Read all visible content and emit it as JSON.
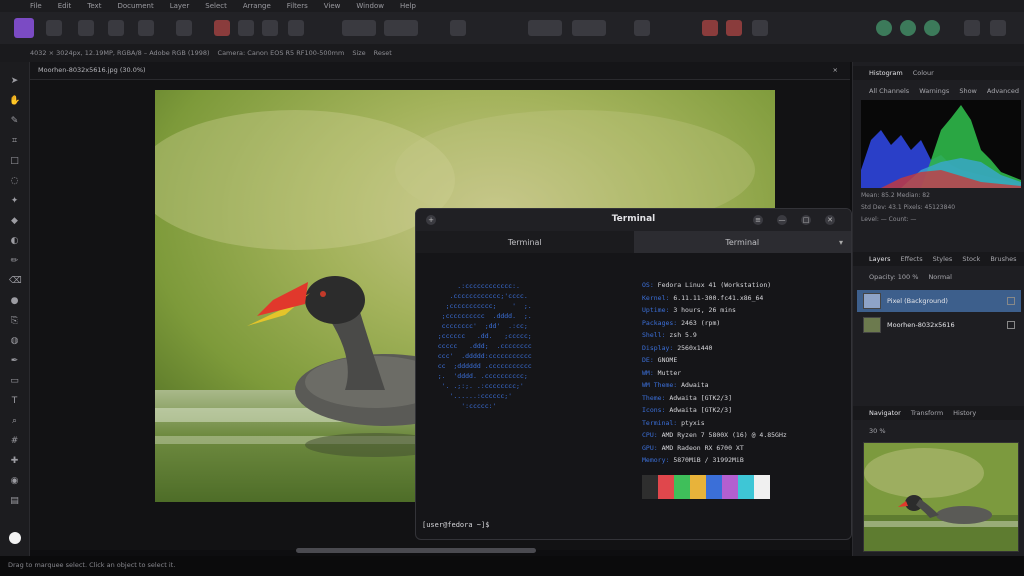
{
  "menu": [
    "File",
    "Edit",
    "Text",
    "Document",
    "Layer",
    "Select",
    "Arrange",
    "Filters",
    "View",
    "Window",
    "Help"
  ],
  "context": {
    "items": [
      "4032 × 3024px, 12.19MP, RGBA/8 – Adobe RGB (1998)",
      "Camera: Canon EOS R5 RF100-500mm",
      "Size",
      "Reset"
    ]
  },
  "document": {
    "tab_title": "Moorhen-8032x5616.jpg (30.0%)",
    "close_glyph": "×"
  },
  "terminal": {
    "title": "Terminal",
    "tabs": [
      "Terminal",
      "Terminal"
    ],
    "tab_caret": "▾",
    "controls": [
      "+",
      "≡",
      "—",
      "□",
      "✕"
    ],
    "logo_lines": [
      "        .:cccccccccccc:.      ",
      "      .cccccccccccc;'cccc.    ",
      "     ;ccccccccccc;    '  ;.   ",
      "    ;cccccccccc  .dddd.  ;.   ",
      "    cccccccc'  ;dd'  .:cc;    ",
      "   ;cccccc   .dd.   ;ccccc;   ",
      "   ccccc   .ddd;  .cccccccc   ",
      "   ccc'  .ddddd:ccccccccccc   ",
      "   cc  ;dddddd .ccccccccccc   ",
      "   ;.  'dddd. .cccccccccc;    ",
      "    '. .;:;. .:cccccccc;'     ",
      "      '......:cccccc;'        ",
      "         ':ccccc:'            "
    ],
    "info": [
      {
        "k": "OS:",
        "v": " Fedora Linux 41 (Workstation)"
      },
      {
        "k": "Kernel:",
        "v": " 6.11.11-300.fc41.x86_64"
      },
      {
        "k": "Uptime:",
        "v": " 3 hours, 26 mins"
      },
      {
        "k": "Packages:",
        "v": " 2463 (rpm)"
      },
      {
        "k": "Shell:",
        "v": " zsh 5.9"
      },
      {
        "k": "Display:",
        "v": " 2560x1440"
      },
      {
        "k": "DE:",
        "v": " GNOME"
      },
      {
        "k": "WM:",
        "v": " Mutter"
      },
      {
        "k": "WM Theme:",
        "v": " Adwaita"
      },
      {
        "k": "Theme:",
        "v": " Adwaita [GTK2/3]"
      },
      {
        "k": "Icons:",
        "v": " Adwaita [GTK2/3]"
      },
      {
        "k": "Terminal:",
        "v": " ptyxis"
      },
      {
        "k": "CPU:",
        "v": " AMD Ryzen 7 5800X (16) @ 4.85GHz"
      },
      {
        "k": "GPU:",
        "v": " AMD Radeon RX 6700 XT"
      },
      {
        "k": "Memory:",
        "v": " 5870MiB / 31992MiB"
      }
    ],
    "swatch_colors": [
      "#2e2e2e",
      "#e0474c",
      "#3fbf5a",
      "#e8b33a",
      "#3b6fd8",
      "#b35fd0",
      "#3ec6d6",
      "#f0f0f0"
    ],
    "prompt": "[user@fedora ~]$"
  },
  "right": {
    "histogram_tabs": [
      "Histogram",
      "Colour"
    ],
    "histogram_controls": [
      "All Channels",
      "Warnings",
      "Show",
      "Advanced"
    ],
    "histogram_rows": [
      "Mean: 85.2  Median: 82",
      "Std Dev: 43.1  Pixels: 45123840",
      "Level: —  Count: —"
    ],
    "layers_tabs": [
      "Layers",
      "Effects",
      "Styles",
      "Stock",
      "Brushes"
    ],
    "layers_opacity": [
      "Opacity: 100 %",
      "Normal"
    ],
    "layers": [
      {
        "name": "Pixel (Background)",
        "selected": true
      },
      {
        "name": "Moorhen-8032x5616",
        "selected": false
      }
    ],
    "navigator_tabs": [
      "Navigator",
      "Transform",
      "History"
    ],
    "navigator_zoom": "30 %"
  },
  "status": {
    "text": "Drag to marquee select. Click an object to select it."
  },
  "colors": {
    "accent": "#7b4bc4",
    "selection": "#3d5f8c",
    "terminal_blue": "#3b6fd8"
  }
}
